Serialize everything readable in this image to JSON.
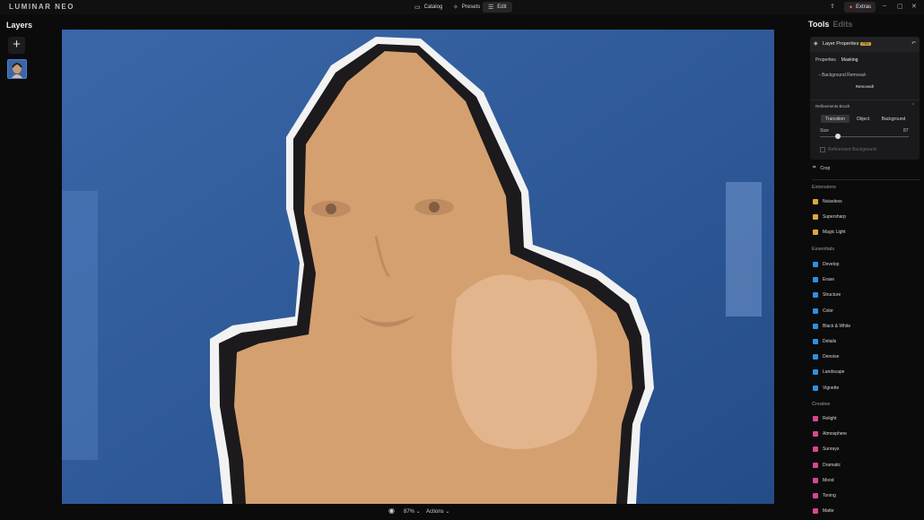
{
  "app": {
    "logo": "LUMINAR NEO"
  },
  "top_nav": [
    {
      "label": "Catalog",
      "icon": "folder-icon"
    },
    {
      "label": "Presets",
      "icon": "presets-icon"
    },
    {
      "label": "Edit",
      "icon": "sliders-icon",
      "active": true
    }
  ],
  "top_right": {
    "extras_label": "Extras"
  },
  "layers": {
    "title": "Layers",
    "add_label": "+"
  },
  "canvas": {
    "subject": "portrait-with-mask-overlay",
    "overlay_color": "#d4a070",
    "background_color": "#2f5a98"
  },
  "bottom_bar": {
    "zoom": "87%",
    "actions": "Actions"
  },
  "panel": {
    "tab_tools": "Tools",
    "tab_edits": "Edits"
  },
  "layer_properties": {
    "title": "Layer Properties",
    "badge": "PRO",
    "tabs": [
      "Properties",
      "Masking"
    ],
    "background_removal_label": "Background Removal",
    "status": "Removed!",
    "refinement_label": "Refinements Brush",
    "modes": [
      "Transition",
      "Object",
      "Background"
    ],
    "active_mode": "Transition",
    "size_label": "Size",
    "size_value": "87",
    "size_fraction": 0.2,
    "refine_checkbox": "Refinement Background"
  },
  "crop": {
    "label": "Crop"
  },
  "sections": {
    "extensions": "Extensions",
    "essentials": "Essentials",
    "creative": "Creative"
  },
  "extensions_tools": [
    {
      "label": "Noiseless",
      "color": "#e0a640"
    },
    {
      "label": "Supersharp",
      "color": "#e0a640"
    },
    {
      "label": "Magic Light",
      "color": "#e0a640"
    }
  ],
  "essentials_tools": [
    {
      "label": "Develop",
      "color": "#2f8fe0"
    },
    {
      "label": "Erase",
      "color": "#2f8fe0"
    },
    {
      "label": "Structure",
      "color": "#2f8fe0"
    },
    {
      "label": "Color",
      "color": "#2f8fe0"
    },
    {
      "label": "Black & White",
      "color": "#2f8fe0"
    },
    {
      "label": "Details",
      "color": "#2f8fe0"
    },
    {
      "label": "Denoise",
      "color": "#2f8fe0"
    },
    {
      "label": "Landscape",
      "color": "#2f8fe0"
    },
    {
      "label": "Vignette",
      "color": "#2f8fe0"
    }
  ],
  "creative_tools": [
    {
      "label": "Relight",
      "color": "#d9468f"
    },
    {
      "label": "Atmosphere",
      "color": "#d9468f"
    },
    {
      "label": "Sunrays",
      "color": "#d9468f"
    },
    {
      "label": "Dramatic",
      "color": "#d9468f"
    },
    {
      "label": "Mood",
      "color": "#d9468f"
    },
    {
      "label": "Toning",
      "color": "#d9468f"
    },
    {
      "label": "Matte",
      "color": "#d9468f"
    }
  ]
}
